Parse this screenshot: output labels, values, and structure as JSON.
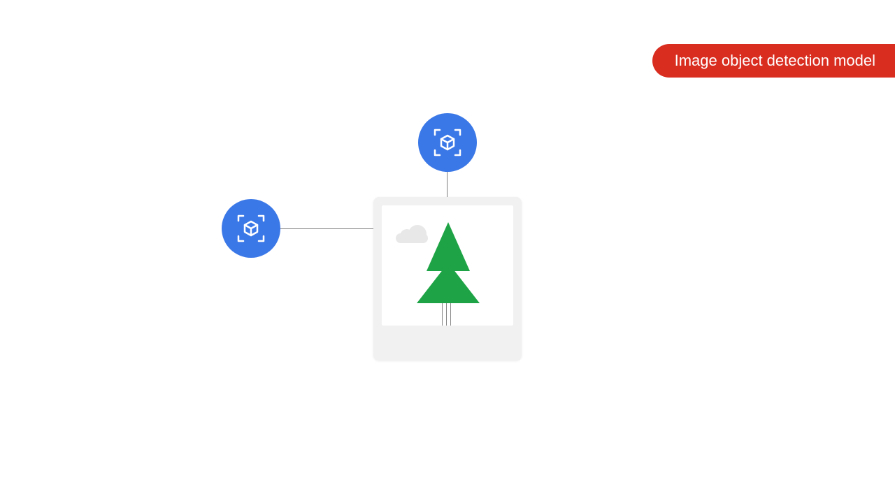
{
  "badge": {
    "label": "Image object detection model"
  },
  "colors": {
    "badge_bg": "#d92d20",
    "node_bg": "#3b78e7",
    "tree": "#1ea446",
    "card_bg": "#f1f1f1"
  },
  "diagram": {
    "nodes": [
      {
        "name": "detection-node-top",
        "icon": "object-detection-box-icon"
      },
      {
        "name": "detection-node-left",
        "icon": "object-detection-box-icon"
      }
    ],
    "image_card": {
      "content": "tree-with-cloud-photo"
    }
  }
}
